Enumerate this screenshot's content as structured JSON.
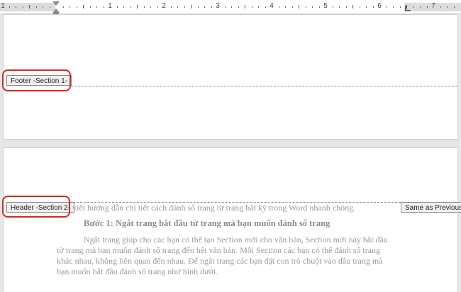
{
  "ruler": {
    "labels": [
      "1",
      "1",
      "2",
      "3",
      "4",
      "5",
      "6",
      "7"
    ]
  },
  "page1": {
    "footer_tag": "Footer -Section 1-"
  },
  "page2": {
    "header_tag": "Header -Section 2-",
    "same_as_previous": "Same as Previous",
    "intro_line": "viết hướng dẫn chi tiết cách đánh số trang từ trang bất kỳ trong Word nhanh chóng.",
    "heading": "Bước 1: Ngắt trang bắt đầu từ trang mà bạn muốn đánh số trang",
    "paragraph_lines": [
      "Ngắt trang giúp cho các bạn có thể tạo Section mới cho văn bản, Section mới này bắt đầu",
      "từ trang mà bạn muốn đánh số trang đến hết văn bản. Mỗi Section các bạn có thể đánh số trang",
      "khác nhau, không liên quan đến nhau. Để ngắt trang các bạn đặt con trỏ chuột vào đầu trang mà",
      "bạn muốn bắt đầu đánh số trang như hình dưới."
    ]
  },
  "colors": {
    "highlight": "#d9261c",
    "faded_text": "#9a9a9a"
  }
}
